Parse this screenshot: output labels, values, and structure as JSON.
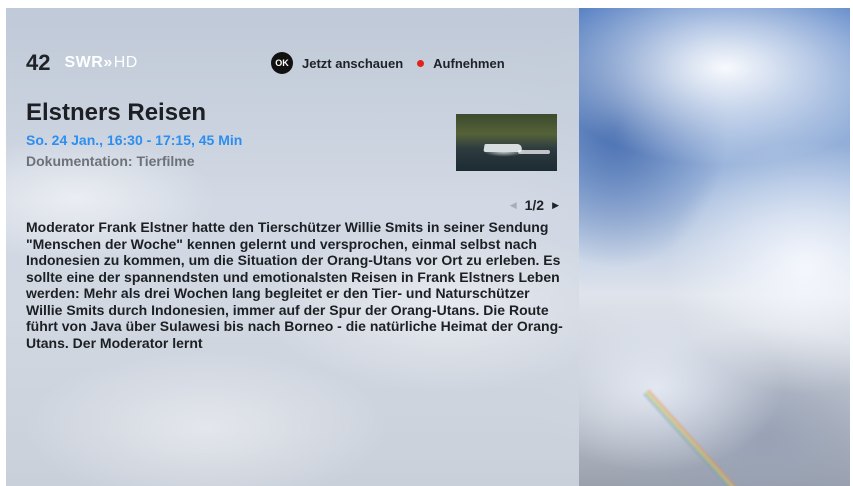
{
  "channel": {
    "number": "42",
    "logo_name": "SWR",
    "logo_arrows": "»",
    "logo_hd": "HD"
  },
  "actions": {
    "watch_key": "OK",
    "watch_label": "Jetzt anschauen",
    "record_label": "Aufnehmen",
    "record_color": "#e2231a"
  },
  "program": {
    "title": "Elstners Reisen",
    "time": "So. 24 Jan., 16:30 - 17:15, 45 Min",
    "genre": "Dokumentation: Tierfilme",
    "description": "Moderator Frank Elstner hatte den Tierschützer Willie Smits in seiner Sendung \"Menschen der Woche\" kennen gelernt und versprochen, einmal selbst nach Indonesien zu kommen, um die Situation der Orang-Utans vor Ort zu erleben. Es sollte eine der spannendsten und emotionalsten Reisen in Frank Elstners Leben werden: Mehr als drei Wochen lang begleitet er den Tier- und Naturschützer Willie Smits durch Indonesien, immer auf der Spur der Orang-Utans. Die Route führt von Java über Sulawesi bis nach Borneo - die natürliche Heimat der Orang-Utans. Der Moderator lernt"
  },
  "pager": {
    "label": "1/2",
    "prev_icon": "◀",
    "next_icon": "▶"
  },
  "colors": {
    "accent_time": "#2d8ef0",
    "genre_text": "#6d7279"
  }
}
